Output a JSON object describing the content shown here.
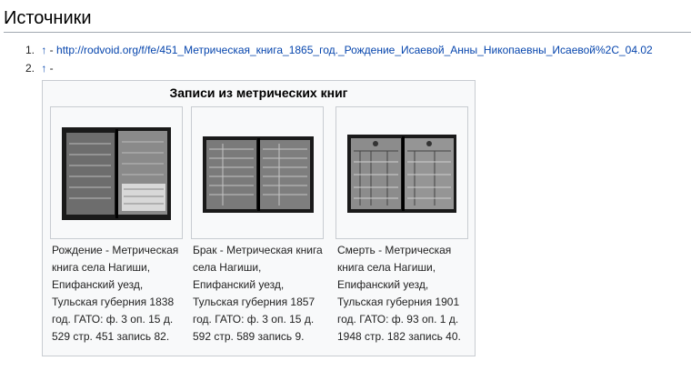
{
  "heading": "Источники",
  "refs": [
    {
      "num": "1.",
      "arrow": "↑",
      "sep": " - ",
      "url": "http://rodvoid.org/f/fe/451_Метрическая_книга_1865_год._Рождение_Исаевой_Анны_Никопаевны_Исаевой%2C_04.02"
    },
    {
      "num": "2.",
      "arrow": "↑",
      "sep": " -",
      "url": ""
    }
  ],
  "gallery": {
    "title": "Записи из метрических книг",
    "items": [
      {
        "caption": "Рождение - Метрическая книга села Нагиши, Епифанский уезд, Тульская губерния 1838 год. ГАТО: ф. 3 оп. 15 д. 529 стр. 451 запись 82."
      },
      {
        "caption": "Брак - Метрическая книга села Нагиши, Епифанский уезд, Тульская губерния 1857 год. ГАТО: ф. 3 оп. 15 д. 592 стр. 589 запись 9."
      },
      {
        "caption": "Смерть - Метрическая книга села Нагиши, Епифанский уезд, Тульская губерния 1901 год. ГАТО: ф. 93 оп. 1 д. 1948 стр. 182 запись 40."
      }
    ]
  },
  "colors": {
    "link": "#0645ad",
    "border": "#c8ccd1",
    "panel": "#f8f9fa"
  }
}
